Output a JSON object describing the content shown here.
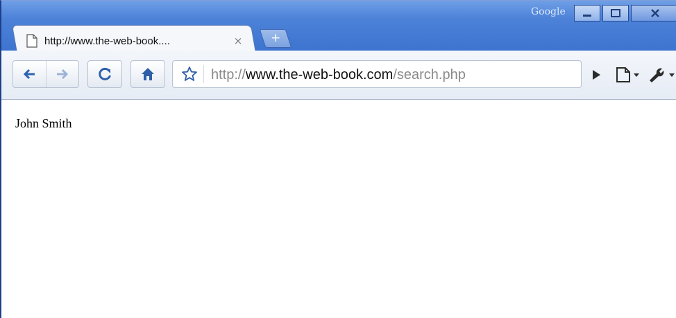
{
  "browser": {
    "brand": "Google",
    "accent": "#4d82d8"
  },
  "tab": {
    "title": "http://www.the-web-book....",
    "close_glyph": "×",
    "new_tab_glyph": "+"
  },
  "address_bar": {
    "url_scheme": "http://",
    "url_host": "www.the-web-book.com",
    "url_path": "/search.php"
  },
  "window_controls": [
    "minimize",
    "maximize",
    "close"
  ],
  "toolbar_icons": [
    "back-icon",
    "forward-icon",
    "reload-icon",
    "home-icon",
    "star-icon",
    "go-icon",
    "page-menu-icon",
    "wrench-menu-icon"
  ],
  "page": {
    "text": "John Smith"
  }
}
